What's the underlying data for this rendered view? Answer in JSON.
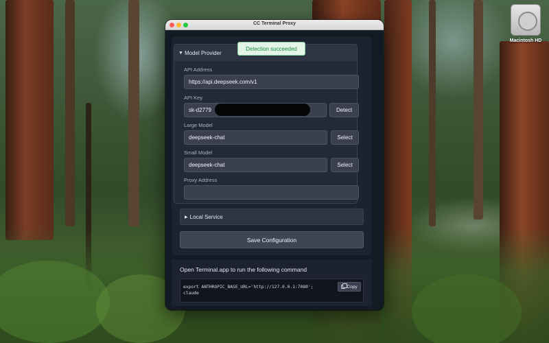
{
  "desktop": {
    "disk_label": "Macintosh HD"
  },
  "window": {
    "title": "CC Terminal Proxy"
  },
  "toast": {
    "message": "Detection succeeded",
    "color": "#1e8a43"
  },
  "model_provider": {
    "header": "Model Provider",
    "expanded": true,
    "api_address": {
      "label": "API Address",
      "value": "https://api.deepseek.com/v1"
    },
    "api_key": {
      "label": "API Key",
      "value": "sk-d2779",
      "redacted": true,
      "button": "Detect"
    },
    "large_model": {
      "label": "Large Model",
      "value": "deepseek-chat",
      "button": "Select"
    },
    "small_model": {
      "label": "Small Model",
      "value": "deepseek-chat",
      "button": "Select"
    },
    "proxy_address": {
      "label": "Proxy Address",
      "value": ""
    }
  },
  "local_service": {
    "header": "Local Service",
    "expanded": false
  },
  "actions": {
    "save_label": "Save Configuration"
  },
  "terminal": {
    "instruction": "Open Terminal.app to run the following command",
    "command_lines": [
      "export ANTHROPIC_BASE_URL='http://127.0.0.1:7080';",
      "claude"
    ],
    "copy_label": "Copy"
  }
}
